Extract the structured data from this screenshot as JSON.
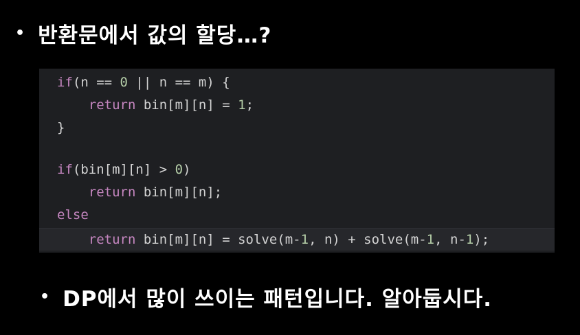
{
  "heading": {
    "bullet": "•",
    "text": "반환문에서 값의 할당…?"
  },
  "code": {
    "lines": [
      {
        "tokens": [
          {
            "t": "if",
            "c": "kw"
          },
          {
            "t": "(n == ",
            "c": ""
          },
          {
            "t": "0",
            "c": "num"
          },
          {
            "t": " || n == m) {",
            "c": ""
          }
        ]
      },
      {
        "tokens": [
          {
            "t": "    ",
            "c": ""
          },
          {
            "t": "return",
            "c": "kw"
          },
          {
            "t": " bin[m][n] = ",
            "c": ""
          },
          {
            "t": "1",
            "c": "num"
          },
          {
            "t": ";",
            "c": ""
          }
        ]
      },
      {
        "tokens": [
          {
            "t": "}",
            "c": ""
          }
        ]
      },
      {
        "tokens": []
      },
      {
        "tokens": [
          {
            "t": "if",
            "c": "kw"
          },
          {
            "t": "(bin[m][n] > ",
            "c": ""
          },
          {
            "t": "0",
            "c": "num"
          },
          {
            "t": ")",
            "c": ""
          }
        ]
      },
      {
        "tokens": [
          {
            "t": "    ",
            "c": ""
          },
          {
            "t": "return",
            "c": "kw"
          },
          {
            "t": " bin[m][n];",
            "c": ""
          }
        ]
      },
      {
        "tokens": [
          {
            "t": "else",
            "c": "kw"
          }
        ]
      },
      {
        "tokens": [
          {
            "t": "    ",
            "c": ""
          },
          {
            "t": "return",
            "c": "kw"
          },
          {
            "t": " bin[m][n] = solve(m-",
            "c": ""
          },
          {
            "t": "1",
            "c": "num"
          },
          {
            "t": ", n) + solve(m-",
            "c": ""
          },
          {
            "t": "1",
            "c": "num"
          },
          {
            "t": ", n-",
            "c": ""
          },
          {
            "t": "1",
            "c": "num"
          },
          {
            "t": ");",
            "c": ""
          }
        ],
        "highlight": true
      }
    ]
  },
  "note": {
    "bullet": "•",
    "text": "DP에서 많이 쓰이는 패턴입니다. 알아둡시다."
  },
  "colors": {
    "background": "#000000",
    "code_bg": "#1e1f22",
    "keyword": "#c586c0",
    "number": "#b5cea8",
    "text": "#d4d4d4"
  }
}
